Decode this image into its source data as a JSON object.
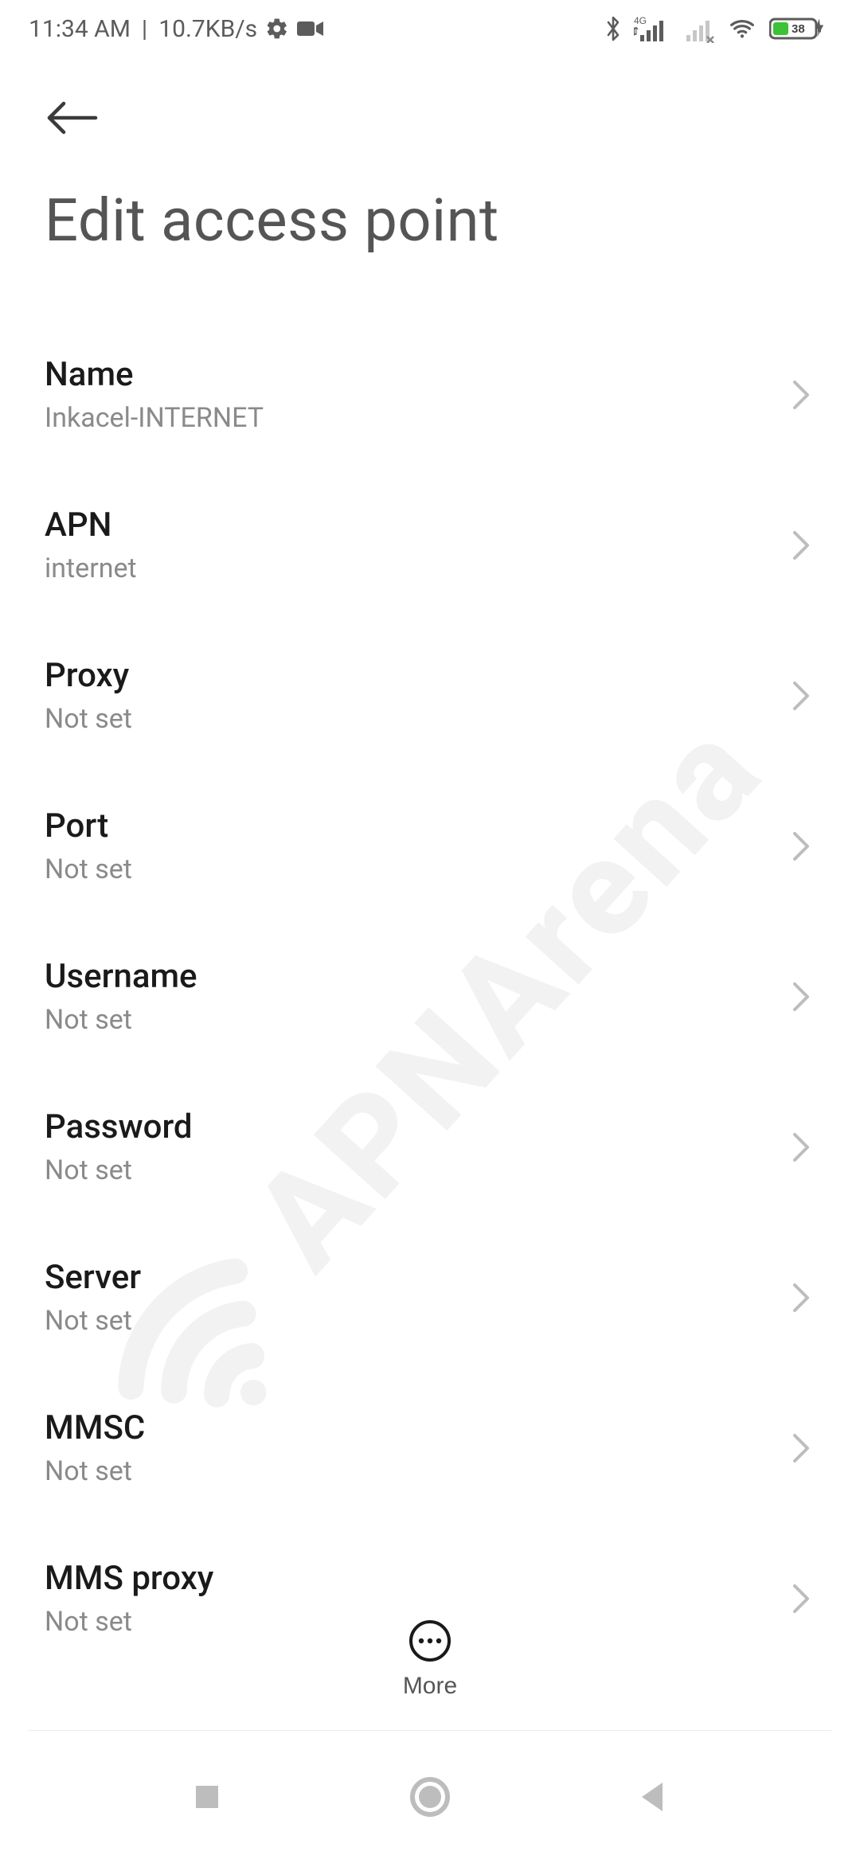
{
  "status": {
    "time": "11:34 AM",
    "separator": "|",
    "net_speed": "10.7KB/s",
    "battery_percent": "38"
  },
  "page": {
    "title": "Edit access point"
  },
  "settings": [
    {
      "label": "Name",
      "value": "Inkacel-INTERNET"
    },
    {
      "label": "APN",
      "value": "internet"
    },
    {
      "label": "Proxy",
      "value": "Not set"
    },
    {
      "label": "Port",
      "value": "Not set"
    },
    {
      "label": "Username",
      "value": "Not set"
    },
    {
      "label": "Password",
      "value": "Not set"
    },
    {
      "label": "Server",
      "value": "Not set"
    },
    {
      "label": "MMSC",
      "value": "Not set"
    },
    {
      "label": "MMS proxy",
      "value": "Not set"
    }
  ],
  "toolbar": {
    "more_label": "More"
  },
  "watermark": {
    "text": "APNArena"
  }
}
